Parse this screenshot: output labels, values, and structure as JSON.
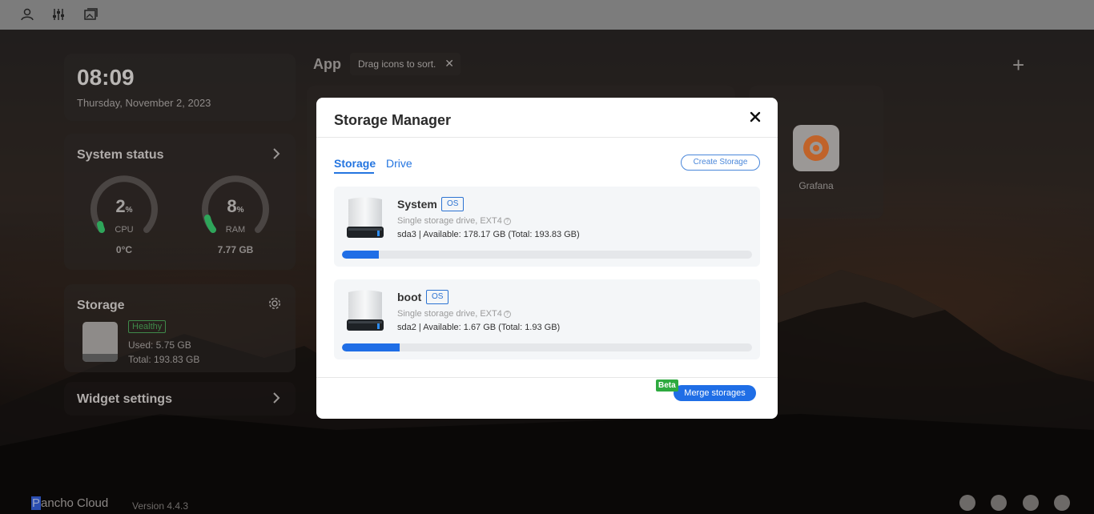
{
  "topbar": {
    "icons": [
      "account-icon",
      "sliders-icon",
      "gallery-icon"
    ]
  },
  "clock": {
    "time": "08:09",
    "date": "Thursday, November 2, 2023"
  },
  "system_status": {
    "title": "System status",
    "cpu": {
      "value": "2",
      "unit": "%",
      "label": "CPU",
      "sub": "0°C",
      "percent": 2
    },
    "ram": {
      "value": "8",
      "unit": "%",
      "label": "RAM",
      "sub": "7.77 GB",
      "percent": 8
    }
  },
  "storage_widget": {
    "title": "Storage",
    "status": "Healthy",
    "used": "Used: 5.75 GB",
    "total": "Total: 193.83 GB"
  },
  "widget_settings": {
    "title": "Widget settings"
  },
  "apps": {
    "title": "App",
    "drag_tip": "Drag icons to sort.",
    "items": [
      {
        "name": "Grafana"
      }
    ]
  },
  "footer": {
    "brand_first": "P",
    "brand_rest": "ancho Cloud",
    "version": "Version 4.4.3"
  },
  "modal": {
    "title": "Storage Manager",
    "tabs": [
      {
        "label": "Storage",
        "active": true
      },
      {
        "label": "Drive",
        "active": false
      }
    ],
    "create_button": "Create Storage",
    "storages": [
      {
        "name": "System",
        "badge": "OS",
        "type": "Single storage drive, EXT4",
        "info": "sda3 | Available: 178.17 GB (Total: 193.83 GB)",
        "used_fraction": 0.09
      },
      {
        "name": "boot",
        "badge": "OS",
        "type": "Single storage drive, EXT4",
        "info": "sda2 | Available: 1.67 GB (Total: 1.93 GB)",
        "used_fraction": 0.14
      }
    ],
    "beta_label": "Beta",
    "merge_button": "Merge storages"
  },
  "colors": {
    "accent": "#1f6ee6",
    "beta": "#2eaa3f",
    "healthy": "#3f8a4a",
    "gauge": "#2ea55a"
  }
}
